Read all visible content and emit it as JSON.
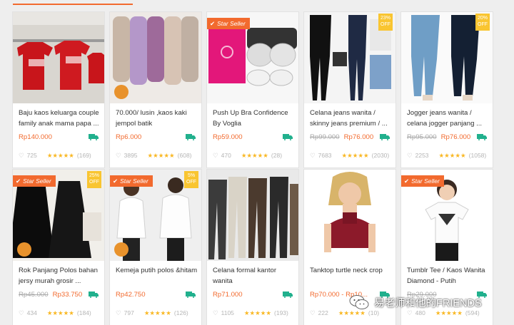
{
  "products": [
    {
      "title": "Baju kaos keluarga couple family anak mama papa ...",
      "old_price": "",
      "price": "Rp140.000",
      "likes": "725",
      "reviews": "(169)",
      "star_seller": false,
      "discount": ""
    },
    {
      "title": "70.000/ lusin ,kaos kaki jempol batik",
      "old_price": "",
      "price": "Rp6.000",
      "likes": "3895",
      "reviews": "(608)",
      "star_seller": false,
      "discount": ""
    },
    {
      "title": "Push Up Bra Confidence By Voglia",
      "old_price": "",
      "price": "Rp59.000",
      "likes": "470",
      "reviews": "(28)",
      "star_seller": true,
      "discount": ""
    },
    {
      "title": "Celana jeans wanita / skinny jeans premium / ...",
      "old_price": "Rp99.000",
      "price": "Rp76.000",
      "likes": "7683",
      "reviews": "(2030)",
      "star_seller": false,
      "discount": "23%"
    },
    {
      "title": "Jogger jeans wanita / celana jogger panjang ...",
      "old_price": "Rp95.000",
      "price": "Rp76.000",
      "likes": "2253",
      "reviews": "(1058)",
      "star_seller": false,
      "discount": "20%"
    },
    {
      "title": "Rok Panjang Polos bahan jersy murah grosir ...",
      "old_price": "Rp45.000",
      "price": "Rp33.750",
      "likes": "434",
      "reviews": "(184)",
      "star_seller": true,
      "discount": "25%"
    },
    {
      "title": "Kemeja putih polos &hitam",
      "old_price": "",
      "price": "Rp42.750",
      "likes": "797",
      "reviews": "(126)",
      "star_seller": true,
      "discount": "5%"
    },
    {
      "title": "Celana formal kantor wanita",
      "old_price": "",
      "price": "Rp71.000",
      "likes": "1105",
      "reviews": "(193)",
      "star_seller": false,
      "discount": ""
    },
    {
      "title": "Tanktop turtle neck crop",
      "old_price": "",
      "price": "Rp70.000 - Rp10...",
      "likes": "222",
      "reviews": "(10)",
      "star_seller": false,
      "discount": ""
    },
    {
      "title": "Tumblr Tee / Kaos Wanita Diamond - Putih",
      "old_price": "Rp29.000",
      "price": "",
      "likes": "480",
      "reviews": "(594)",
      "star_seller": true,
      "discount": ""
    }
  ],
  "labels": {
    "star_seller": "Star Seller",
    "off": "OFF"
  },
  "icons": {
    "heart": "heart-icon",
    "star": "star-icon",
    "truck": "free-shipping-truck-icon",
    "check": "check-icon"
  },
  "colors": {
    "accent": "#f26a2e",
    "discount_badge": "#f9c531",
    "star": "#f9b824",
    "shipping": "#21b08d"
  },
  "stars_display": "★★★★★",
  "watermark": {
    "text": "易老师和他的FRIENDS"
  }
}
